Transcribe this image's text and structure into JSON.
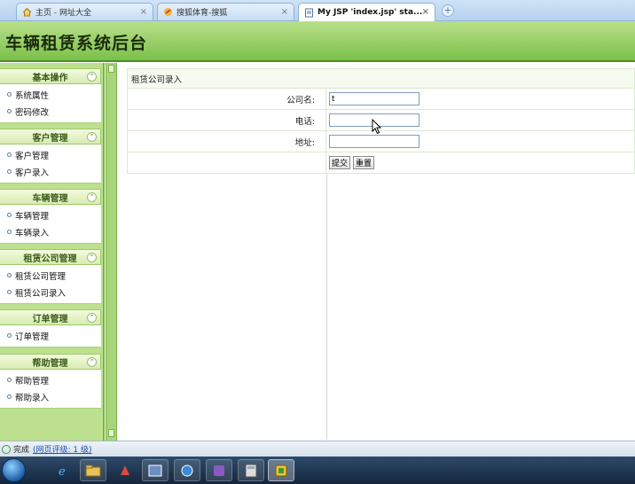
{
  "browser": {
    "tabs": [
      {
        "label": "主页 - 网址大全"
      },
      {
        "label": "搜狐体育-搜狐"
      },
      {
        "label": "My JSP 'index.jsp' sta..."
      }
    ],
    "close_glyph": "×",
    "new_tab_glyph": "+"
  },
  "header": {
    "title": "车辆租赁系统后台"
  },
  "sidebar": {
    "groups": [
      {
        "title": "基本操作",
        "items": [
          "系统属性",
          "密码修改"
        ]
      },
      {
        "title": "客户管理",
        "items": [
          "客户管理",
          "客户录入"
        ]
      },
      {
        "title": "车辆管理",
        "items": [
          "车辆管理",
          "车辆录入"
        ]
      },
      {
        "title": "租赁公司管理",
        "items": [
          "租赁公司管理",
          "租赁公司录入"
        ]
      },
      {
        "title": "订单管理",
        "items": [
          "订单管理"
        ]
      },
      {
        "title": "帮助管理",
        "items": [
          "帮助管理",
          "帮助录入"
        ]
      }
    ],
    "collapse_glyph": "⌃"
  },
  "form": {
    "caption": "租赁公司录入",
    "fields": [
      {
        "label": "公司名:",
        "value": "t"
      },
      {
        "label": "电话:",
        "value": ""
      },
      {
        "label": "地址:",
        "value": ""
      }
    ],
    "submit_label": "提交",
    "reset_label": "重置"
  },
  "status": {
    "text": "完成",
    "link": "(网页评级: 1 级)"
  },
  "taskbar": {
    "items": [
      "ie-icon",
      "explorer-icon",
      "app-icon",
      "window-icon",
      "browser-icon",
      "media-icon",
      "calculator-icon",
      "active-app-icon"
    ]
  }
}
